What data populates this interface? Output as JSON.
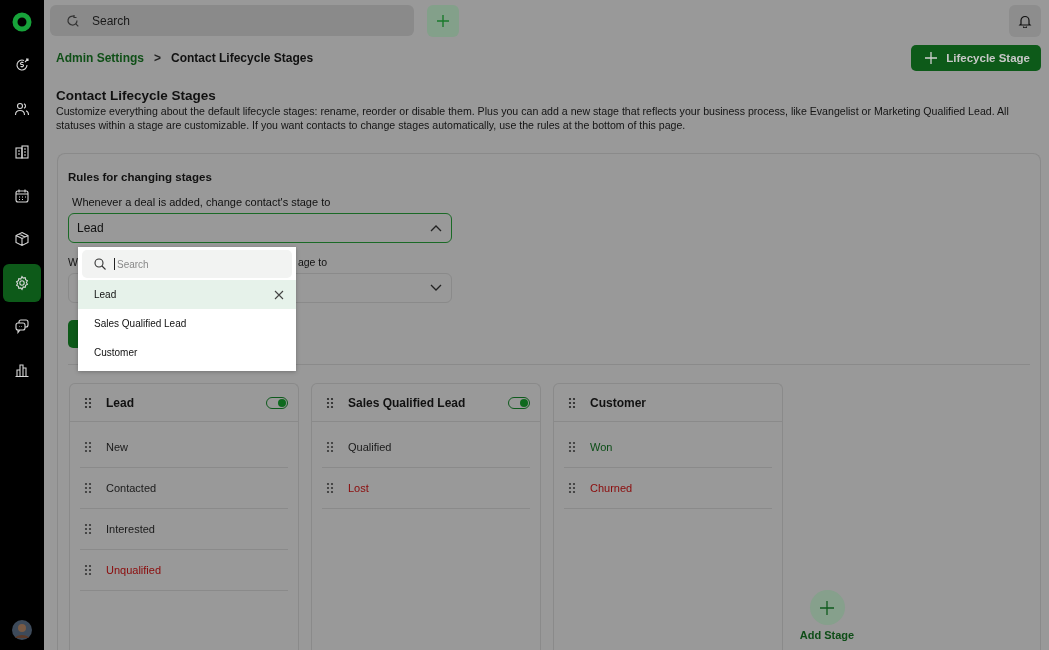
{
  "sidebar": {
    "items": [
      {
        "kind": "dollar",
        "selected": false
      },
      {
        "kind": "users",
        "selected": false
      },
      {
        "kind": "building",
        "selected": false
      },
      {
        "kind": "calendar",
        "selected": false
      },
      {
        "kind": "box",
        "selected": false
      },
      {
        "kind": "gear",
        "selected": true
      },
      {
        "kind": "chat",
        "selected": false
      },
      {
        "kind": "chart",
        "selected": false
      }
    ]
  },
  "top_bar": {
    "search": {
      "placeholder": "Search"
    }
  },
  "breadcrumb": {
    "parent": "Admin Settings",
    "separator": ">",
    "current": "Contact Lifecycle Stages"
  },
  "add_button": {
    "label": "Lifecycle Stage"
  },
  "page": {
    "title": "Contact Lifecycle Stages",
    "description": "Customize everything about the default lifecycle stages: rename, reorder or disable them. Plus you can add a new stage that reflects your business process, like Evangelist or Marketing Qualified Lead. All statuses within a stage are customizable. If you want contacts to change stages automatically, use the rules at the bottom of this page."
  },
  "rules": {
    "title": "Rules for changing stages",
    "rule_1": {
      "label": "Whenever a deal is added, change contact's stage to",
      "value": "Lead",
      "expanded": true
    },
    "rule_2": {
      "label_start": "W",
      "label_end": "age to",
      "expanded": false
    }
  },
  "dropdown": {
    "search": {
      "placeholder": "Search"
    },
    "options": [
      {
        "label": "Lead",
        "selected": true
      },
      {
        "label": "Sales Qualified Lead",
        "selected": false
      },
      {
        "label": "Customer",
        "selected": false
      }
    ]
  },
  "stages": [
    {
      "name": "Lead",
      "on": true,
      "statuses": [
        {
          "label": "New",
          "color": "#1a1a1a"
        },
        {
          "label": "Contacted",
          "color": "#1a1a1a"
        },
        {
          "label": "Interested",
          "color": "#1a1a1a"
        },
        {
          "label": "Unqualified",
          "color": "#8b0a0a"
        }
      ]
    },
    {
      "name": "Sales Qualified Lead",
      "on": true,
      "statuses": [
        {
          "label": "Qualified",
          "color": "#1a1a1a"
        },
        {
          "label": "Lost",
          "color": "#8b0a0a"
        }
      ]
    },
    {
      "name": "Customer",
      "statuses": [
        {
          "label": "Won",
          "color": "#0b4d16"
        },
        {
          "label": "Churned",
          "color": "#8b0a0a"
        }
      ]
    }
  ],
  "add_stage": {
    "label": "Add Stage"
  }
}
